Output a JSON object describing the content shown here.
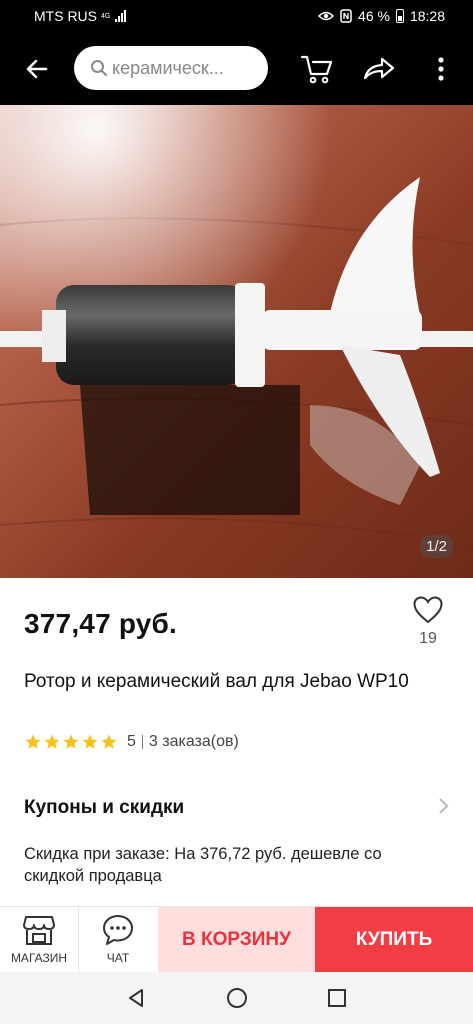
{
  "status_bar": {
    "carrier": "MTS RUS",
    "network": "4G",
    "battery": "46 %",
    "time": "18:28"
  },
  "toolbar": {
    "search_placeholder": "керамическ...",
    "icons": [
      "back-arrow-icon",
      "search-icon",
      "cart-icon",
      "share-icon",
      "more-vert-icon"
    ]
  },
  "gallery": {
    "counter": "1/2"
  },
  "product": {
    "price": "377,47 руб.",
    "wishlist_count": "19",
    "title": "Ротор и керамический вал для Jebao WP10",
    "rating": "5",
    "rating_stars": 5,
    "orders": "3 заказа(ов)"
  },
  "coupons": {
    "title": "Купоны и скидки",
    "discount_text": "Скидка при заказе: На 376,72 руб. дешевле со скидкой продавца"
  },
  "action_bar": {
    "store_label": "МАГАЗИН",
    "chat_label": "ЧАТ",
    "add_to_cart": "В КОРЗИНУ",
    "buy_now": "КУПИТЬ"
  },
  "colors": {
    "accent": "#f23d44",
    "accent_light": "#ffdede",
    "star": "#f6c21b"
  }
}
